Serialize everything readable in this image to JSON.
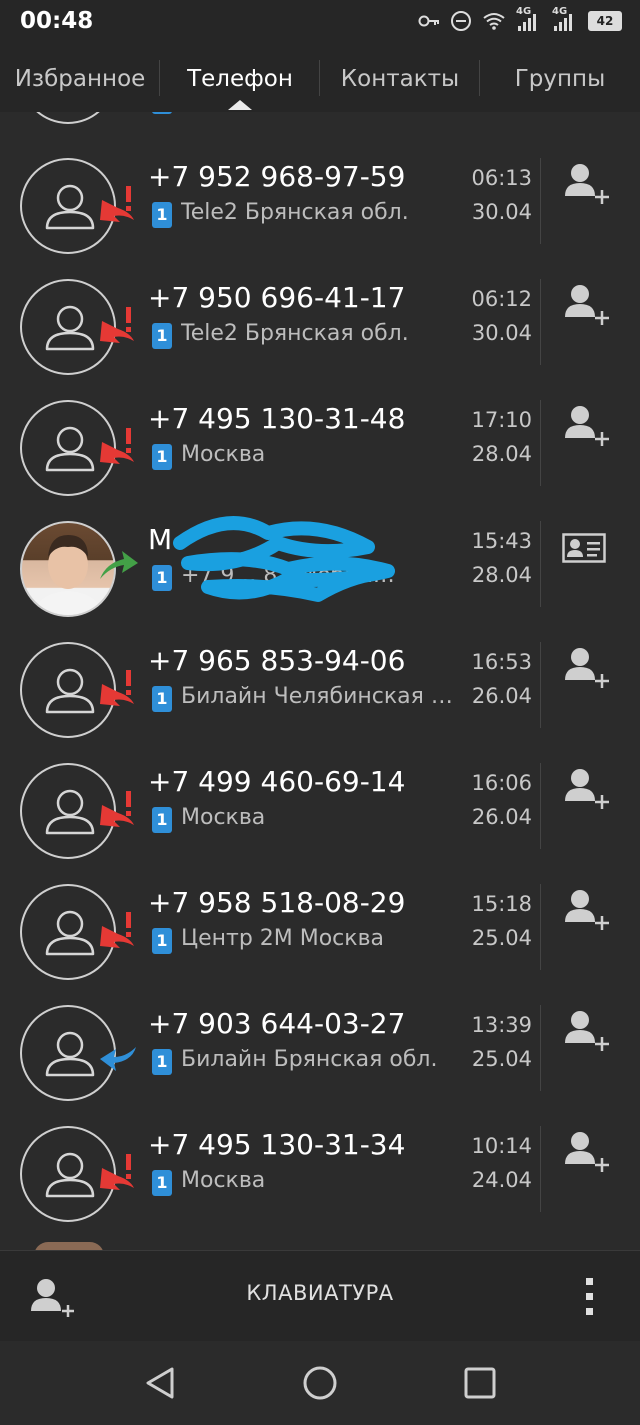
{
  "status_bar": {
    "time": "00:48",
    "battery": "42",
    "network_1": "4G",
    "network_2": "4G",
    "icons": [
      "key-icon",
      "dnd-icon",
      "wifi-icon",
      "signal-icon",
      "signal-icon",
      "battery-icon"
    ]
  },
  "tabs": [
    {
      "label": "Избранное"
    },
    {
      "label": "Телефон"
    },
    {
      "label": "Контакты"
    },
    {
      "label": "Группы"
    }
  ],
  "active_tab": "Телефон",
  "calls": [
    {
      "primary": "+7 952 968-97-59",
      "sim": "1",
      "secondary": "Tele2 Брянская обл.",
      "time": "06:13",
      "date": "30.04",
      "type": "missed"
    },
    {
      "primary": "+7 950 696-41-17",
      "sim": "1",
      "secondary": "Tele2 Брянская обл.",
      "time": "06:12",
      "date": "30.04",
      "type": "missed"
    },
    {
      "primary": "+7 495 130-31-48",
      "sim": "1",
      "secondary": "Москва",
      "time": "17:10",
      "date": "28.04",
      "type": "missed"
    },
    {
      "primary": "М",
      "sim": "1",
      "secondary": "+7 9… 82 Мобил…",
      "time": "15:43",
      "date": "28.04",
      "type": "outgoing"
    },
    {
      "primary": "+7 965 853-94-06",
      "sim": "1",
      "secondary": "Билайн Челябинская обл.",
      "time": "16:53",
      "date": "26.04",
      "type": "missed"
    },
    {
      "primary": "+7 499 460-69-14",
      "sim": "1",
      "secondary": "Москва",
      "time": "16:06",
      "date": "26.04",
      "type": "missed"
    },
    {
      "primary": "+7 958 518-08-29",
      "sim": "1",
      "secondary": "Центр 2М Москва",
      "time": "15:18",
      "date": "25.04",
      "type": "missed"
    },
    {
      "primary": "+7 903 644-03-27",
      "sim": "1",
      "secondary": "Билайн Брянская обл.",
      "time": "13:39",
      "date": "25.04",
      "type": "incoming"
    },
    {
      "primary": "+7 495 130-31-34",
      "sim": "1",
      "secondary": "Москва",
      "time": "10:14",
      "date": "24.04",
      "type": "missed"
    }
  ],
  "bottom_bar": {
    "keyboard_label": "КЛАВИАТУРА"
  },
  "colors": {
    "background": "#2b2b2b",
    "missed": "#e53935",
    "outgoing": "#43a047",
    "incoming": "#2f8fd8",
    "sim_badge": "#2f8fd8"
  }
}
